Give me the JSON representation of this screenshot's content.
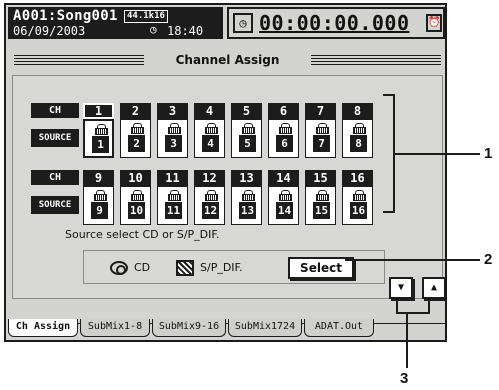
{
  "header": {
    "song": "A001:Song001",
    "sample_rate": "44.1k16",
    "date": "06/09/2003",
    "clock_icon": "clock-icon",
    "time": "18:40",
    "counter": "00:00:00.000",
    "timecode_icon": "timecode-icon",
    "alarm_icon": "alarm-clock-icon"
  },
  "title": "Channel Assign",
  "table": {
    "ch_label": "CH",
    "source_label": "SOURCE",
    "row1": [
      "1",
      "2",
      "3",
      "4",
      "5",
      "6",
      "7",
      "8"
    ],
    "row2": [
      "9",
      "10",
      "11",
      "12",
      "13",
      "14",
      "15",
      "16"
    ],
    "source_icon": "track-input-icon"
  },
  "hint": "Source select CD or S/P_DIF.",
  "source_select": {
    "cd_label": "CD",
    "spdif_label": "S/P_DIF.",
    "select_label": "Select",
    "cd_icon": "cd-icon",
    "spdif_icon": "spdif-icon"
  },
  "arrows": {
    "down_icon": "scroll-down-icon",
    "up_icon": "scroll-up-icon"
  },
  "tabs": [
    "Ch Assign",
    "SubMix1-8",
    "SubMix9-16",
    "SubMix1724",
    "ADAT.Out"
  ],
  "callouts": [
    "1",
    "2",
    "3"
  ]
}
